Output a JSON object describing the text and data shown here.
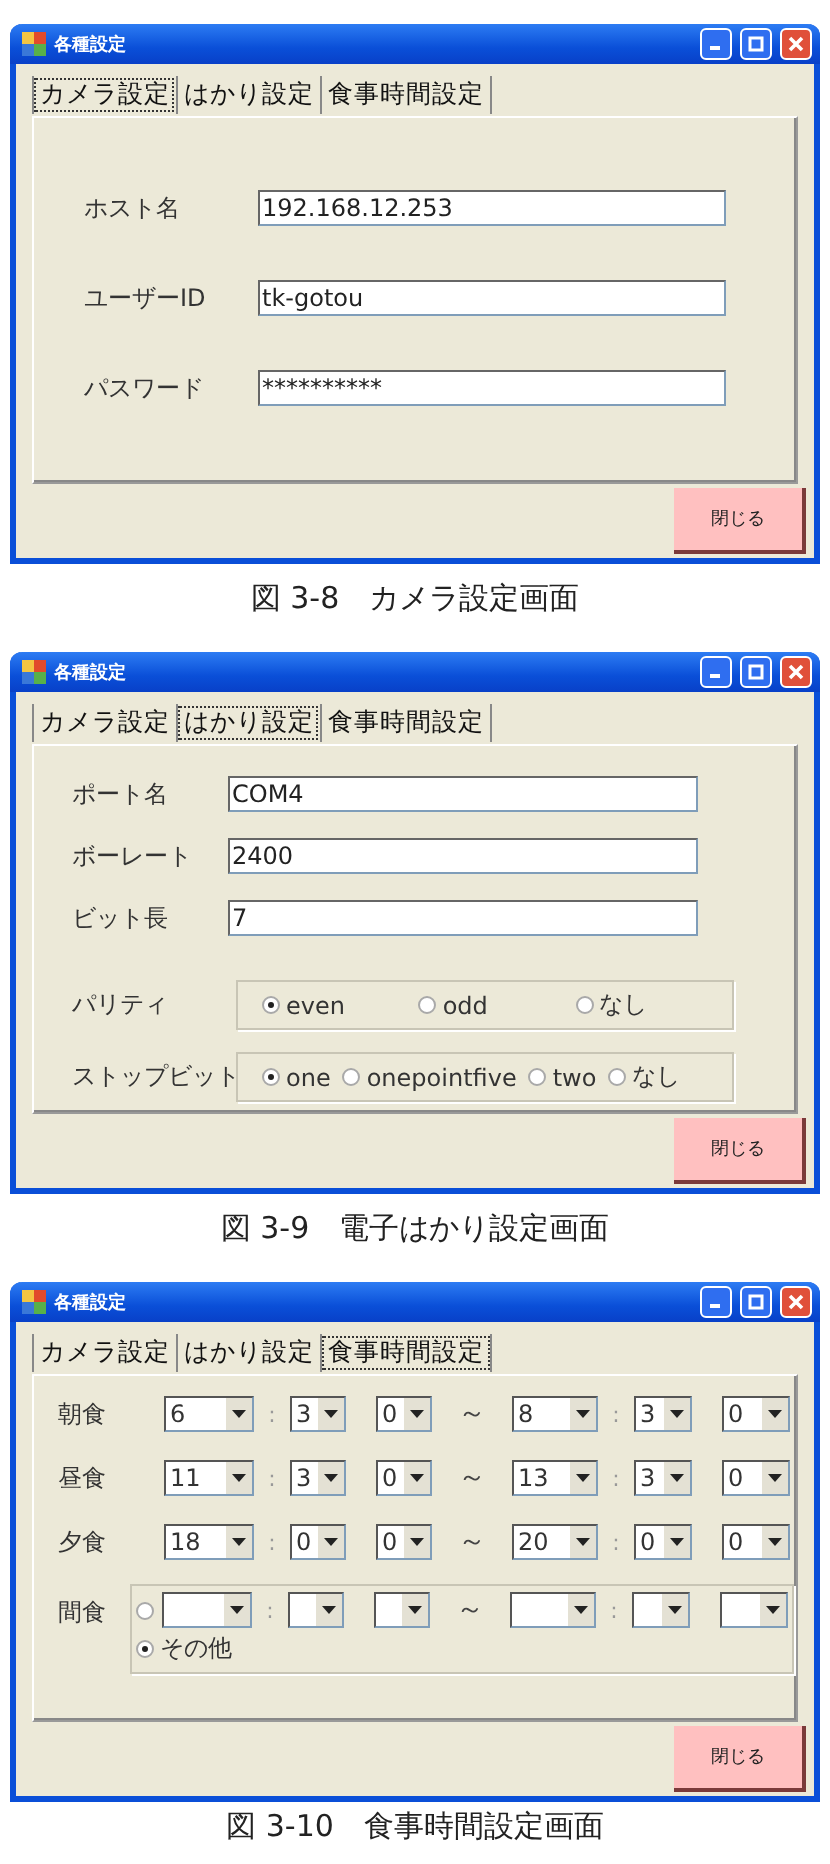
{
  "figures": [
    {
      "kind": "camera",
      "window": {
        "title": "各種設定"
      },
      "tabs": [
        {
          "label": "カメラ設定",
          "selected": true
        },
        {
          "label": "はかり設定",
          "selected": false
        },
        {
          "label": "食事時間設定",
          "selected": false
        }
      ],
      "fields": [
        {
          "label": "ホスト名",
          "value": "192.168.12.253"
        },
        {
          "label": "ユーザーID",
          "value": "tk-gotou"
        },
        {
          "label": "パスワード",
          "value": "**********"
        }
      ],
      "close_button": "閉じる",
      "caption": "図 3-8　カメラ設定画面"
    },
    {
      "kind": "scale",
      "window": {
        "title": "各種設定"
      },
      "tabs": [
        {
          "label": "カメラ設定",
          "selected": false
        },
        {
          "label": "はかり設定",
          "selected": true
        },
        {
          "label": "食事時間設定",
          "selected": false
        }
      ],
      "fields": [
        {
          "label": "ポート名",
          "value": "COM4"
        },
        {
          "label": "ボーレート",
          "value": "2400"
        },
        {
          "label": "ビット長",
          "value": "7"
        }
      ],
      "radio_groups": [
        {
          "label": "パリティ",
          "options": [
            {
              "label": "even",
              "selected": true
            },
            {
              "label": "odd",
              "selected": false
            },
            {
              "label": "なし",
              "selected": false
            }
          ]
        },
        {
          "label": "ストップビット",
          "options": [
            {
              "label": "one",
              "selected": true
            },
            {
              "label": "onepointfive",
              "selected": false
            },
            {
              "label": "two",
              "selected": false
            },
            {
              "label": "なし",
              "selected": false
            }
          ]
        }
      ],
      "close_button": "閉じる",
      "caption": "図 3-9　電子はかり設定画面"
    },
    {
      "kind": "meals",
      "window": {
        "title": "各種設定"
      },
      "tabs": [
        {
          "label": "カメラ設定",
          "selected": false
        },
        {
          "label": "はかり設定",
          "selected": false
        },
        {
          "label": "食事時間設定",
          "selected": true
        }
      ],
      "meals": [
        {
          "label": "朝食",
          "start": {
            "hour": "6",
            "separator": ":",
            "minute_1": "3",
            "minute_2": "0"
          },
          "range_mark": "～",
          "end": {
            "hour": "8",
            "separator": ":",
            "minute_1": "3",
            "minute_2": "0"
          }
        },
        {
          "label": "昼食",
          "start": {
            "hour": "11",
            "separator": ":",
            "minute_1": "3",
            "minute_2": "0"
          },
          "range_mark": "～",
          "end": {
            "hour": "13",
            "separator": ":",
            "minute_1": "3",
            "minute_2": "0"
          }
        },
        {
          "label": "夕食",
          "start": {
            "hour": "18",
            "separator": ":",
            "minute_1": "0",
            "minute_2": "0"
          },
          "range_mark": "～",
          "end": {
            "hour": "20",
            "separator": ":",
            "minute_1": "0",
            "minute_2": "0"
          }
        }
      ],
      "snack": {
        "label": "間食",
        "time_selected": false,
        "start": {
          "separator": ":"
        },
        "range_mark": "～",
        "end": {
          "separator": ":"
        },
        "other": {
          "label": "その他",
          "selected": true
        }
      },
      "close_button": "閉じる",
      "caption": "図 3-10　食事時間設定画面"
    }
  ]
}
